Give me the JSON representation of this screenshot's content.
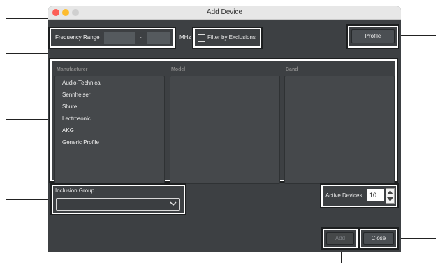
{
  "window": {
    "title": "Add Device"
  },
  "frequency": {
    "label": "Frequency Range",
    "low_value": "",
    "separator": "-",
    "high_value": "",
    "unit": "MHz"
  },
  "filter": {
    "label": "Filter by Exclusions",
    "checked": false
  },
  "profile_button": {
    "label": "Profile"
  },
  "columns": {
    "manufacturer": "Manufacturer",
    "model": "Model",
    "band": "Band"
  },
  "manufacturers": [
    "Audio-Technica",
    "Sennheiser",
    "Shure",
    "Lectrosonic",
    "AKG",
    "Generic Profile"
  ],
  "inclusion_group": {
    "label": "Inclusion Group",
    "value": ""
  },
  "active_devices": {
    "label": "Active Devices",
    "value": "10"
  },
  "buttons": {
    "add": "Add",
    "close": "Close"
  },
  "colors": {
    "window_bg": "#3d4043",
    "titlebar": "#e7e7e7",
    "highlight": "#ffffff",
    "close_dot": "#fc5f57",
    "minimize_dot": "#fdbc2e"
  }
}
